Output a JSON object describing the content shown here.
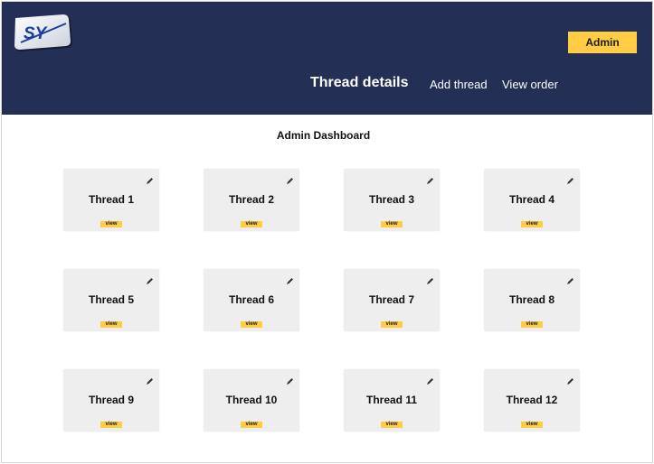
{
  "header": {
    "logo_text": "SY",
    "admin_label": "Admin",
    "nav": {
      "active": "Thread details",
      "add": "Add thread",
      "order": "View order"
    }
  },
  "main": {
    "title": "Admin Dashboard",
    "view_label": "view",
    "threads": [
      "Thread 1",
      "Thread 2",
      "Thread 3",
      "Thread 4",
      "Thread 5",
      "Thread 6",
      "Thread 7",
      "Thread 8",
      "Thread 9",
      "Thread 10",
      "Thread 11",
      "Thread 12"
    ]
  },
  "colors": {
    "header_bg": "#232f55",
    "accent": "#ffcc44",
    "card_bg": "#eeeeee"
  },
  "icons": {
    "logo": "sy-logo",
    "edit": "pencil-icon"
  }
}
